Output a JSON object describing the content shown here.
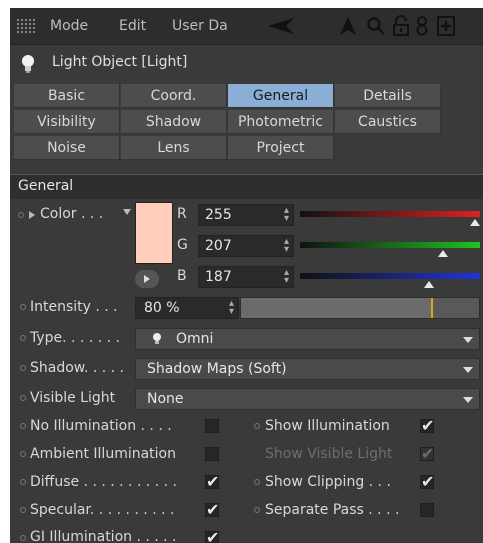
{
  "toolbar": {
    "menu": [
      "Mode",
      "Edit",
      "User Da"
    ],
    "icons": [
      "back-arrow-icon",
      "cursor-icon",
      "search-icon",
      "lock-icon",
      "link-icon",
      "add-panel-icon"
    ]
  },
  "object": {
    "title": "Light Object [Light]",
    "icon": "light-bulb-icon"
  },
  "tabs": [
    {
      "label": "Basic",
      "active": false
    },
    {
      "label": "Coord.",
      "active": false
    },
    {
      "label": "General",
      "active": true
    },
    {
      "label": "Details",
      "active": false
    },
    {
      "label": "Visibility",
      "active": false
    },
    {
      "label": "Shadow",
      "active": false
    },
    {
      "label": "Photometric",
      "active": false
    },
    {
      "label": "Caustics",
      "active": false
    },
    {
      "label": "Noise",
      "active": false
    },
    {
      "label": "Lens",
      "active": false
    },
    {
      "label": "Project",
      "active": false
    }
  ],
  "section_title": "General",
  "color": {
    "label": "Color . . .",
    "swatch": "#ffcfbb",
    "r": {
      "label": "R",
      "value": "255",
      "fraction": 1.0
    },
    "g": {
      "label": "G",
      "value": "207",
      "fraction": 0.81
    },
    "b": {
      "label": "B",
      "value": "187",
      "fraction": 0.73
    }
  },
  "intensity": {
    "label": "Intensity . . .",
    "value": "80 %",
    "fraction": 0.8
  },
  "type": {
    "label": "Type. . . . . . .",
    "value": "Omni"
  },
  "shadow": {
    "label": "Shadow. . . . .",
    "value": "Shadow Maps (Soft)"
  },
  "visible_light": {
    "label": "Visible Light",
    "value": "None"
  },
  "checks": [
    {
      "label": "No Illumination . . . .",
      "checked": false
    },
    {
      "label": "Show Illumination",
      "checked": true
    },
    {
      "label": "Ambient Illumination",
      "checked": false
    },
    {
      "label": "Show Visible Light",
      "checked": true,
      "disabled": true
    },
    {
      "label": "Diffuse . . . . . . . . . . .",
      "checked": true
    },
    {
      "label": "Show Clipping . . .",
      "checked": true
    },
    {
      "label": "Specular. . . . . . . . . .",
      "checked": true
    },
    {
      "label": "Separate Pass . . . .",
      "checked": false
    },
    {
      "label": "GI Illumination . . . . .",
      "checked": true
    }
  ],
  "check_mark": "✔",
  "colors": {
    "accent_tab": "#8aaed6",
    "intensity_marker": "#e8a21a"
  }
}
